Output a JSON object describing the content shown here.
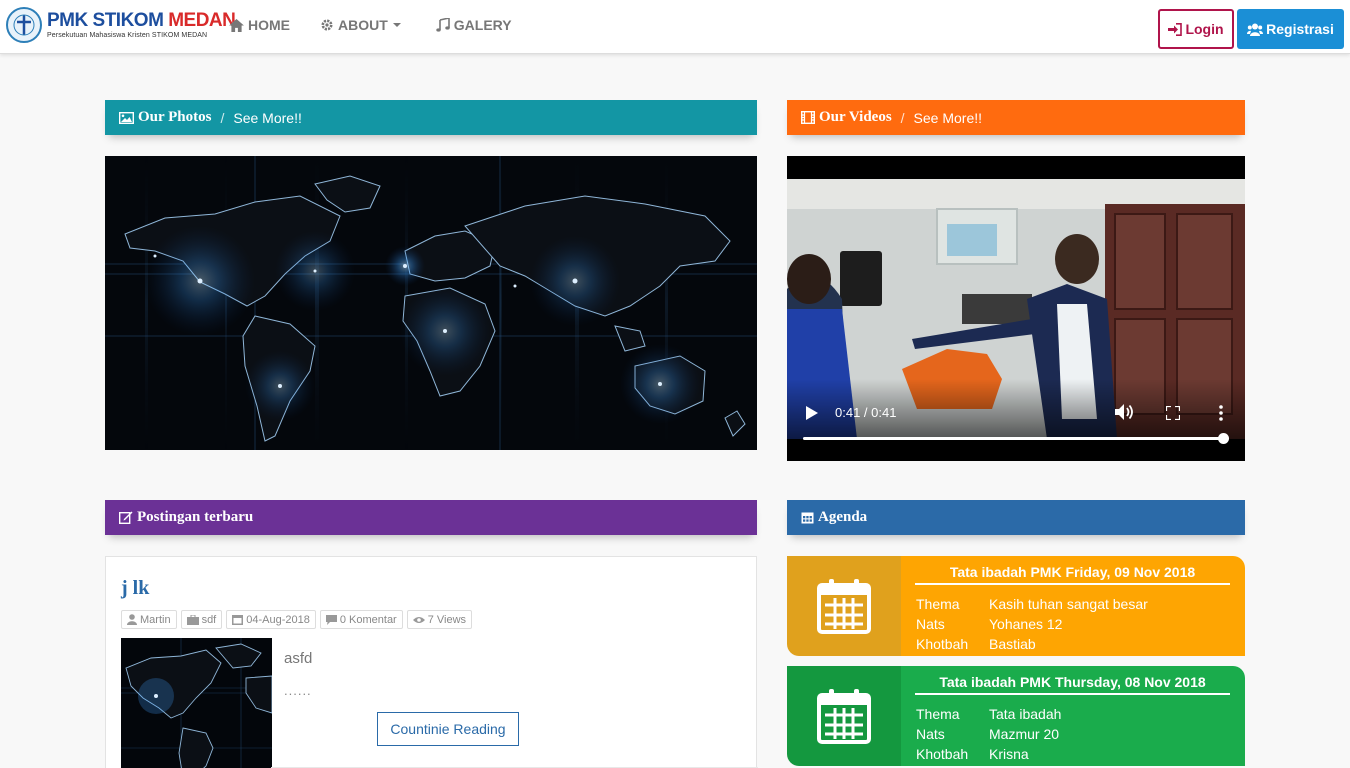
{
  "brand": {
    "title_pmk": "PMK",
    "title_stikom": "STIKOM",
    "title_medan": "MEDAN",
    "subtitle": "Persekutuan Mahasiswa Kristen STIKOM MEDAN"
  },
  "nav": {
    "home": "HOME",
    "about": "ABOUT",
    "galery": "GALERY",
    "login": "Login",
    "register": "Registrasi"
  },
  "photos": {
    "title": "Our Photos",
    "separator": "/",
    "more": "See More!!"
  },
  "videos": {
    "title": "Our Videos",
    "separator": "/",
    "more": "See More!!",
    "time": "0:41 / 0:41",
    "progress": 1.0
  },
  "posts": {
    "title": "Postingan terbaru",
    "latest": {
      "title": "j lk",
      "author": "Martin",
      "category": "sdf",
      "date": "04-Aug-2018",
      "comments": "0 Komentar",
      "views": "7 Views",
      "excerpt": "asfd",
      "ellipsis": "......",
      "button": "Countinie Reading"
    }
  },
  "agenda": {
    "title": "Agenda",
    "items": [
      {
        "title": "Tata ibadah PMK Friday, 09 Nov 2018",
        "thema_label": "Thema",
        "thema": "Kasih tuhan sangat besar",
        "nats_label": "Nats",
        "nats": "Yohanes 12",
        "khotbah_label": "Khotbah",
        "khotbah": "Bastiab"
      },
      {
        "title": "Tata ibadah PMK Thursday, 08 Nov 2018",
        "thema_label": "Thema",
        "thema": "Tata ibadah",
        "nats_label": "Nats",
        "nats": "Mazmur 20",
        "khotbah_label": "Khotbah",
        "khotbah": "Krisna"
      }
    ]
  },
  "colors": {
    "photos_header": "#1396a4",
    "videos_header": "#ff6b0f",
    "posts_header": "#6b3196",
    "agenda_header": "#2b6aa8",
    "agenda_orange": "#fea502",
    "agenda_green": "#1aac4c",
    "login_border": "#b0144b",
    "register_bg": "#1b8fd6"
  }
}
